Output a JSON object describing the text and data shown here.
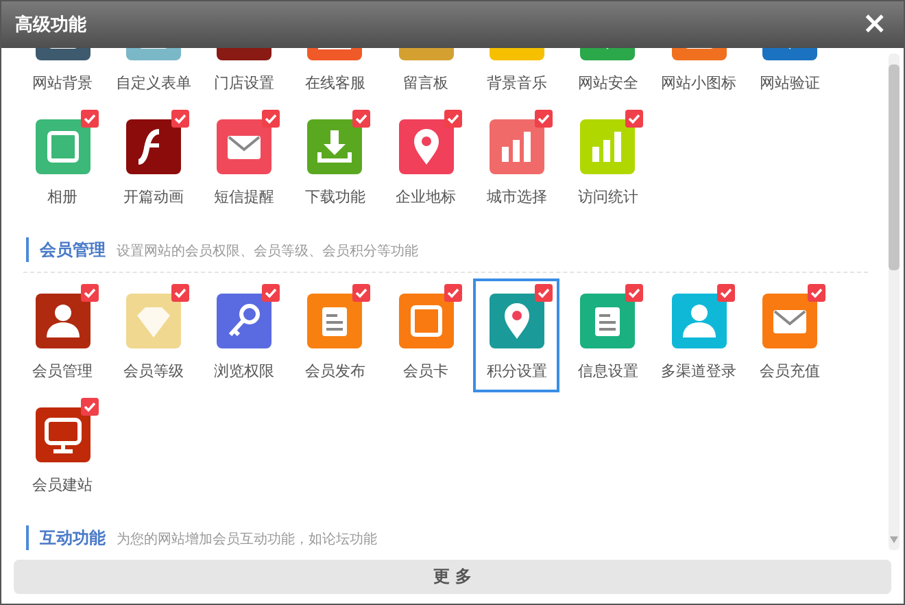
{
  "window": {
    "title": "高级功能",
    "close": "×"
  },
  "sections": [
    {
      "items": [
        {
          "label": "网站背景",
          "color": "#3d5a6e",
          "selected": false
        },
        {
          "label": "自定义表单",
          "color": "#7ab8c8",
          "selected": false
        },
        {
          "label": "门店设置",
          "color": "#8a1a14",
          "selected": false
        },
        {
          "label": "在线客服",
          "color": "#f05a28",
          "selected": false
        },
        {
          "label": "留言板",
          "color": "#d4a030",
          "selected": false
        },
        {
          "label": "背景音乐",
          "color": "#f6c000",
          "selected": false
        },
        {
          "label": "网站安全",
          "color": "#2aa84a",
          "selected": false
        },
        {
          "label": "网站小图标",
          "color": "#f07020",
          "selected": false
        },
        {
          "label": "网站验证",
          "color": "#1a72c0",
          "selected": false
        },
        {
          "label": "相册",
          "color": "#3cb878",
          "checked": true,
          "selected": false
        },
        {
          "label": "开篇动画",
          "color": "#8c0c0c",
          "checked": true,
          "selected": false
        },
        {
          "label": "短信提醒",
          "color": "#f04a5a",
          "checked": true,
          "selected": false
        },
        {
          "label": "下载功能",
          "color": "#5aa820",
          "checked": true,
          "selected": false
        },
        {
          "label": "企业地标",
          "color": "#f0405a",
          "checked": true,
          "selected": false
        },
        {
          "label": "城市选择",
          "color": "#f06a6a",
          "checked": true,
          "selected": false
        },
        {
          "label": "访问统计",
          "color": "#b0d800",
          "checked": true,
          "selected": false
        }
      ]
    },
    {
      "title": "会员管理",
      "description": "设置网站的会员权限、会员等级、会员积分等功能",
      "items": [
        {
          "label": "会员管理",
          "color": "#b02a10",
          "checked": true,
          "selected": false
        },
        {
          "label": "会员等级",
          "color": "#f0d890",
          "checked": true,
          "selected": false
        },
        {
          "label": "浏览权限",
          "color": "#5a6ae0",
          "checked": true,
          "selected": false
        },
        {
          "label": "会员发布",
          "color": "#f88010",
          "checked": true,
          "selected": false
        },
        {
          "label": "会员卡",
          "color": "#f87a10",
          "checked": true,
          "selected": false
        },
        {
          "label": "积分设置",
          "color": "#1a9a98",
          "checked": true,
          "selected": true
        },
        {
          "label": "信息设置",
          "color": "#1ab080",
          "checked": true,
          "selected": false
        },
        {
          "label": "多渠道登录",
          "color": "#10b8d8",
          "checked": true,
          "selected": false
        },
        {
          "label": "会员充值",
          "color": "#f87a10",
          "checked": true,
          "selected": false
        },
        {
          "label": "会员建站",
          "color": "#c02a08",
          "checked": true,
          "selected": false
        }
      ]
    },
    {
      "title": "互动功能",
      "description": "为您的网站增加会员互动功能，如论坛功能"
    }
  ],
  "more_button": "更 多"
}
